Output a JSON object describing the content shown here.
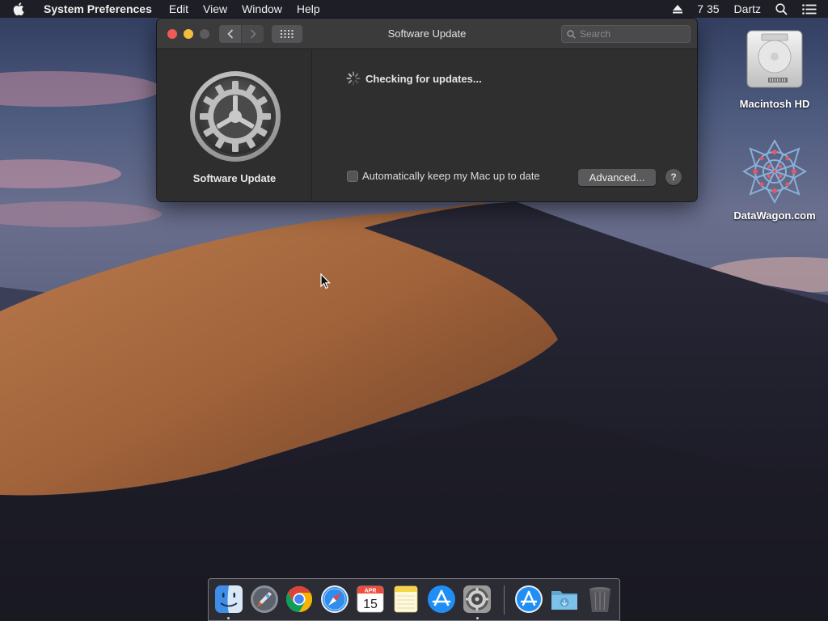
{
  "menubar": {
    "apple_icon": "apple-logo-icon",
    "app_name": "System Preferences",
    "menus": [
      "Edit",
      "View",
      "Window",
      "Help"
    ],
    "clock": "7 35",
    "user": "Dartz",
    "status_icons": [
      "eject-icon",
      "spotlight-search-icon",
      "notification-center-icon"
    ]
  },
  "window": {
    "title": "Software Update",
    "search_placeholder": "Search",
    "sidebar_label": "Software Update",
    "status_text": "Checking for updates...",
    "auto_update_label": "Automatically keep my Mac up to date",
    "auto_update_checked": false,
    "advanced_label": "Advanced...",
    "help_label": "?"
  },
  "desktop_icons": [
    {
      "label": "Macintosh HD",
      "icon": "hard-drive-icon"
    },
    {
      "label": "DataWagon.com",
      "icon": "datawagon-logo-icon"
    }
  ],
  "dock": {
    "items": [
      {
        "name": "Finder",
        "icon": "finder-icon",
        "running": true
      },
      {
        "name": "Launchpad",
        "icon": "launchpad-icon",
        "running": false
      },
      {
        "name": "Google Chrome",
        "icon": "chrome-icon",
        "running": false
      },
      {
        "name": "Safari",
        "icon": "safari-icon",
        "running": false
      },
      {
        "name": "Calendar",
        "icon": "calendar-icon",
        "running": false,
        "month": "APR",
        "day": "15"
      },
      {
        "name": "Notes",
        "icon": "notes-icon",
        "running": false
      },
      {
        "name": "App Store",
        "icon": "app-store-icon",
        "running": false
      },
      {
        "name": "System Preferences",
        "icon": "system-preferences-icon",
        "running": true
      },
      {
        "name": "Applications",
        "icon": "app-store-folder-icon",
        "running": false
      },
      {
        "name": "Downloads",
        "icon": "downloads-folder-icon",
        "running": false
      },
      {
        "name": "Trash",
        "icon": "trash-icon",
        "running": false
      }
    ]
  },
  "colors": {
    "close": "#ee5b55",
    "minimize": "#f4be3d",
    "window_bg": "#2f2f30",
    "titlebar_bg": "#3b3b3c"
  }
}
